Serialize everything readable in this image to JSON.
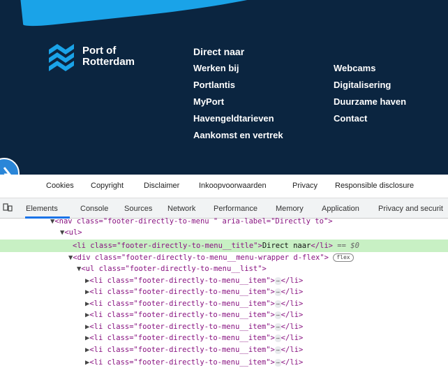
{
  "logo": {
    "line1": "Port of",
    "line2": "Rotterdam"
  },
  "nav_title": "Direct naar",
  "nav_col1": [
    "Werken bij",
    "Portlantis",
    "MyPort",
    "Havengeldtarieven",
    "Aankomst en vertrek"
  ],
  "nav_col2": [
    "Webcams",
    "Digitalisering",
    "Duurzame haven",
    "Contact"
  ],
  "footer_links": [
    "Cookies",
    "Copyright",
    "Disclaimer",
    "Inkoopvoorwaarden",
    "Privacy",
    "Responsible disclosure"
  ],
  "devtools": {
    "tabs": [
      "Elements",
      "Console",
      "Sources",
      "Network",
      "Performance",
      "Memory",
      "Application",
      "Privacy and securit"
    ],
    "code": {
      "l0_pre": "<nav class=\"footer-directly-to-menu \" aria-label=\"Directly to\">",
      "l1": "<ul>",
      "l2_tag_open": "<li class=\"footer-directly-to-menu__title\">",
      "l2_text": "Direct naar",
      "l2_tag_close": "</li>",
      "l2_suffix": " == $0",
      "l3_tag": "<div class=\"footer-directly-to-menu__menu-wrapper d-flex\">",
      "l3_pill": "flex",
      "l4_tag": "<ul class=\"footer-directly-to-menu__list\">",
      "item_tag_open": "<li class=\"footer-directly-to-menu__item\">",
      "item_dots": "⋯",
      "item_tag_close": "</li>"
    }
  },
  "colors": {
    "site_bg": "#0b2540",
    "accent": "#1aa3e8",
    "highlight": "#c8f0c4"
  }
}
